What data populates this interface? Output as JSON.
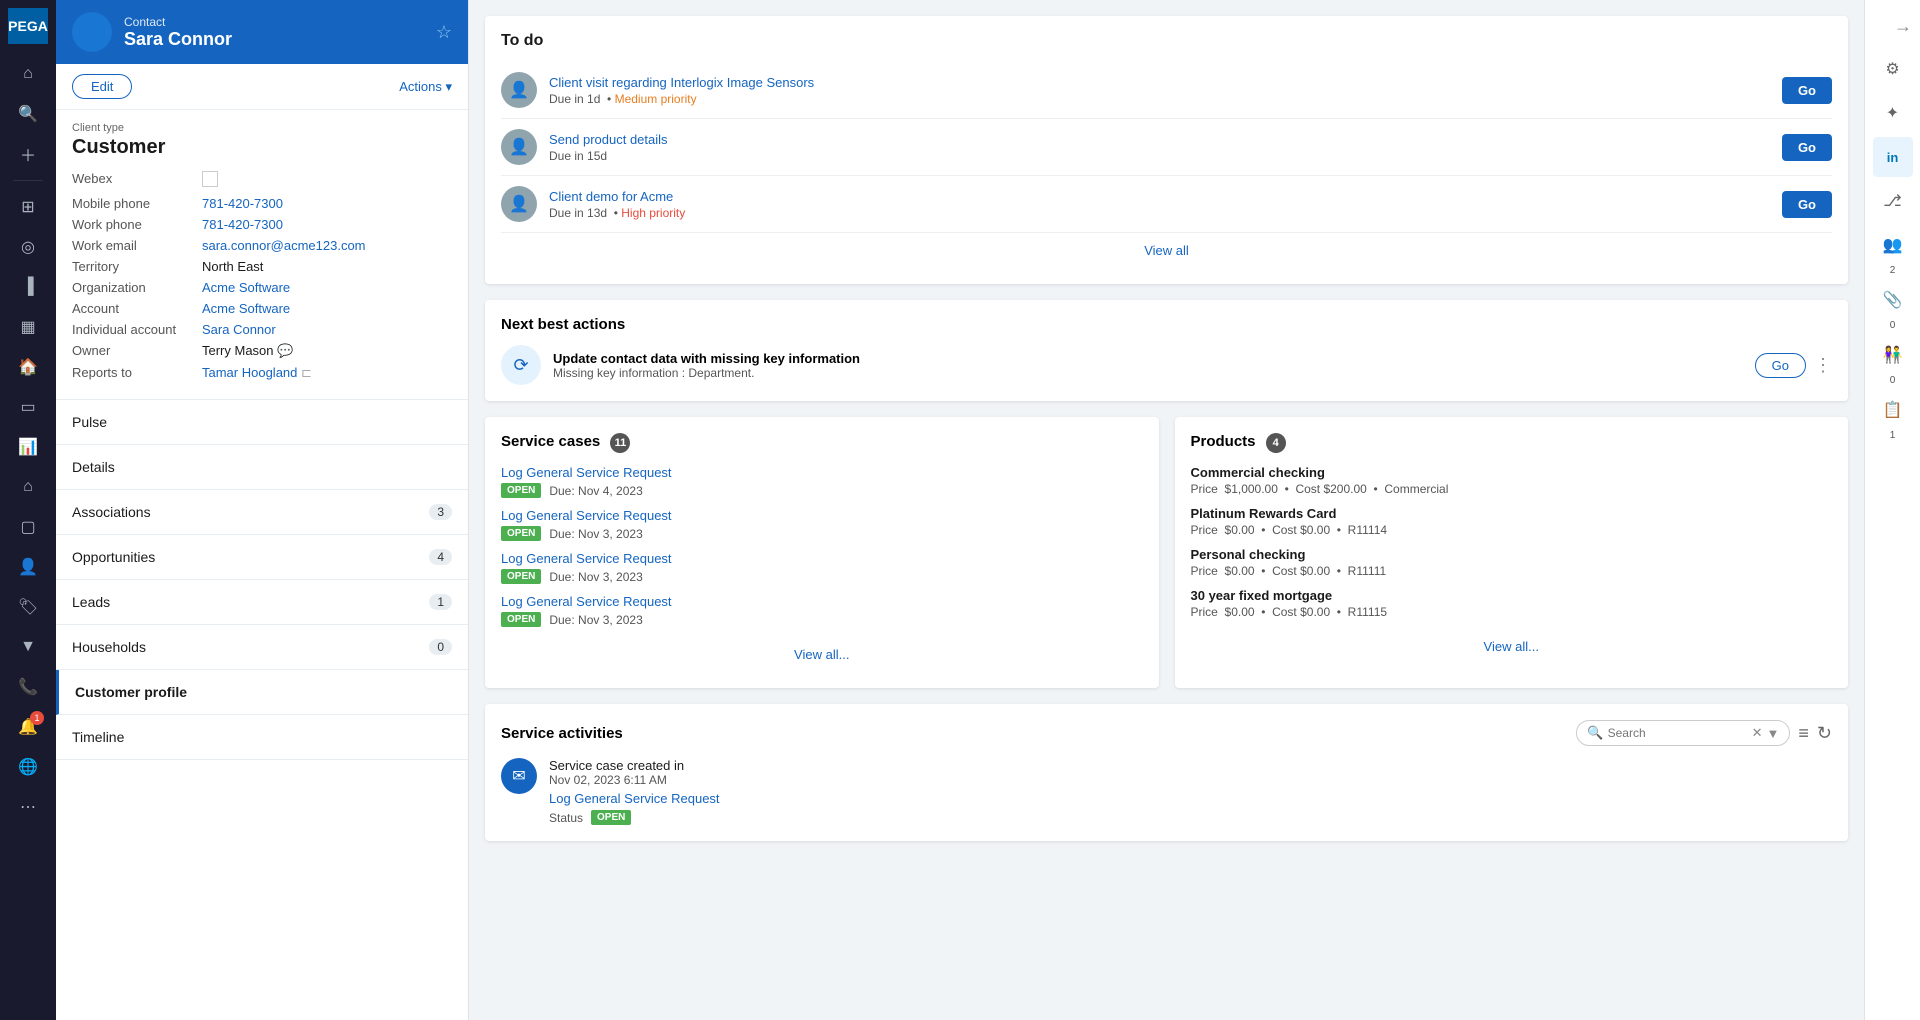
{
  "app": {
    "title": "PEGA"
  },
  "left_nav": {
    "icons": [
      {
        "name": "home-icon",
        "symbol": "⌂",
        "active": false
      },
      {
        "name": "search-icon",
        "symbol": "🔍",
        "active": false
      },
      {
        "name": "plus-icon",
        "symbol": "+",
        "active": false
      },
      {
        "name": "dashboard-icon",
        "symbol": "⊞",
        "active": false
      },
      {
        "name": "search2-icon",
        "symbol": "🔍",
        "active": false
      },
      {
        "name": "chart-icon",
        "symbol": "📊",
        "active": false
      },
      {
        "name": "grid-icon",
        "symbol": "▦",
        "active": false
      },
      {
        "name": "bookmark-icon",
        "symbol": "🔖",
        "active": false
      },
      {
        "name": "desktop-icon",
        "symbol": "🖥",
        "active": false
      },
      {
        "name": "bar-chart-icon",
        "symbol": "📈",
        "active": false
      },
      {
        "name": "house-icon",
        "symbol": "🏠",
        "active": false
      },
      {
        "name": "folder-icon",
        "symbol": "📁",
        "active": false
      },
      {
        "name": "person-icon",
        "symbol": "👤",
        "active": true
      },
      {
        "name": "tag-icon",
        "symbol": "🏷",
        "active": false
      },
      {
        "name": "filter-icon",
        "symbol": "▼",
        "active": false
      },
      {
        "name": "phone-icon",
        "symbol": "📞",
        "active": false
      },
      {
        "name": "bell-icon",
        "symbol": "🔔",
        "active": false,
        "badge": "1"
      },
      {
        "name": "globe-icon",
        "symbol": "🌐",
        "active": false
      },
      {
        "name": "more-dots-icon",
        "symbol": "⋯",
        "active": false
      }
    ]
  },
  "sidebar": {
    "contact_label": "Contact",
    "contact_name": "Sara Connor",
    "edit_label": "Edit",
    "actions_label": "Actions ▾",
    "client_type_label": "Client type",
    "client_type_value": "Customer",
    "fields": [
      {
        "label": "Webex",
        "value": "",
        "type": "webex"
      },
      {
        "label": "Mobile phone",
        "value": "781-420-7300",
        "type": "link"
      },
      {
        "label": "Work phone",
        "value": "781-420-7300",
        "type": "link"
      },
      {
        "label": "Work email",
        "value": "sara.connor@acme123.com",
        "type": "link"
      },
      {
        "label": "Territory",
        "value": "North East",
        "type": "text"
      },
      {
        "label": "Organization",
        "value": "Acme Software",
        "type": "link"
      },
      {
        "label": "Account",
        "value": "Acme Software",
        "type": "link"
      },
      {
        "label": "Individual account",
        "value": "Sara Connor",
        "type": "link"
      },
      {
        "label": "Owner",
        "value": "Terry Mason",
        "type": "text"
      },
      {
        "label": "Reports to",
        "value": "Tamar Hoogland",
        "type": "link"
      }
    ],
    "sections": [
      {
        "label": "Pulse",
        "badge": null,
        "active": false
      },
      {
        "label": "Details",
        "badge": null,
        "active": false
      },
      {
        "label": "Associations",
        "badge": "3",
        "active": false
      },
      {
        "label": "Opportunities",
        "badge": "4",
        "active": false
      },
      {
        "label": "Leads",
        "badge": "1",
        "active": false
      },
      {
        "label": "Households",
        "badge": "0",
        "active": false
      },
      {
        "label": "Customer profile",
        "badge": null,
        "active": true,
        "bold": true
      },
      {
        "label": "Timeline",
        "badge": null,
        "active": false
      }
    ]
  },
  "todo": {
    "title": "To do",
    "items": [
      {
        "title": "Client visit regarding Interlogix Image Sensors",
        "meta": "Due in 1d",
        "priority_label": "Medium priority",
        "priority_type": "medium"
      },
      {
        "title": "Send product details",
        "meta": "Due in 15d",
        "priority_label": "",
        "priority_type": ""
      },
      {
        "title": "Client demo for Acme",
        "meta": "Due in 13d",
        "priority_label": "High priority",
        "priority_type": "high"
      }
    ],
    "go_label": "Go",
    "view_all_label": "View all"
  },
  "nba": {
    "title": "Next best actions",
    "action_title": "Update contact data with missing key information",
    "action_sub": "Missing key information : Department.",
    "go_label": "Go"
  },
  "service_cases": {
    "title": "Service cases",
    "count": "11",
    "items": [
      {
        "label": "Log General Service Request",
        "status": "OPEN",
        "due": "Due: Nov 4, 2023"
      },
      {
        "label": "Log General Service Request",
        "status": "OPEN",
        "due": "Due: Nov 3, 2023"
      },
      {
        "label": "Log General Service Request",
        "status": "OPEN",
        "due": "Due: Nov 3, 2023"
      },
      {
        "label": "Log General Service Request",
        "status": "OPEN",
        "due": "Due: Nov 3, 2023"
      }
    ],
    "view_all_label": "View all..."
  },
  "products": {
    "title": "Products",
    "count": "4",
    "items": [
      {
        "name": "Commercial checking",
        "price": "$1,000.00",
        "cost": "$200.00",
        "code": "Commercial"
      },
      {
        "name": "Platinum Rewards Card",
        "price": "$0.00",
        "cost": "$0.00",
        "code": "R11114"
      },
      {
        "name": "Personal checking",
        "price": "$0.00",
        "cost": "$0.00",
        "code": "R11111"
      },
      {
        "name": "30 year fixed mortgage",
        "price": "$0.00",
        "cost": "$0.00",
        "code": "R11115"
      }
    ],
    "view_all_label": "View all..."
  },
  "service_activities": {
    "title": "Service activities",
    "search_placeholder": "Search",
    "activity": {
      "title": "Service case created  in",
      "date": "Nov 02, 2023 6:11 AM",
      "link": "Log General Service Request",
      "status_label": "Status",
      "status_value": "OPEN"
    }
  },
  "right_panel": {
    "collapse_icon": "→",
    "icons": [
      {
        "name": "settings-icon",
        "symbol": "⚙",
        "count": null
      },
      {
        "name": "sparkle-icon",
        "symbol": "✦",
        "count": null
      },
      {
        "name": "linkedin-icon",
        "symbol": "in",
        "count": null
      },
      {
        "name": "share-icon",
        "symbol": "⎇",
        "count": null
      },
      {
        "name": "people-icon",
        "symbol": "👥",
        "count": "2"
      },
      {
        "name": "paperclip-icon",
        "symbol": "📎",
        "count": "0"
      },
      {
        "name": "team-icon",
        "symbol": "👫",
        "count": "0"
      },
      {
        "name": "clipboard-icon",
        "symbol": "📋",
        "count": "1"
      }
    ]
  }
}
